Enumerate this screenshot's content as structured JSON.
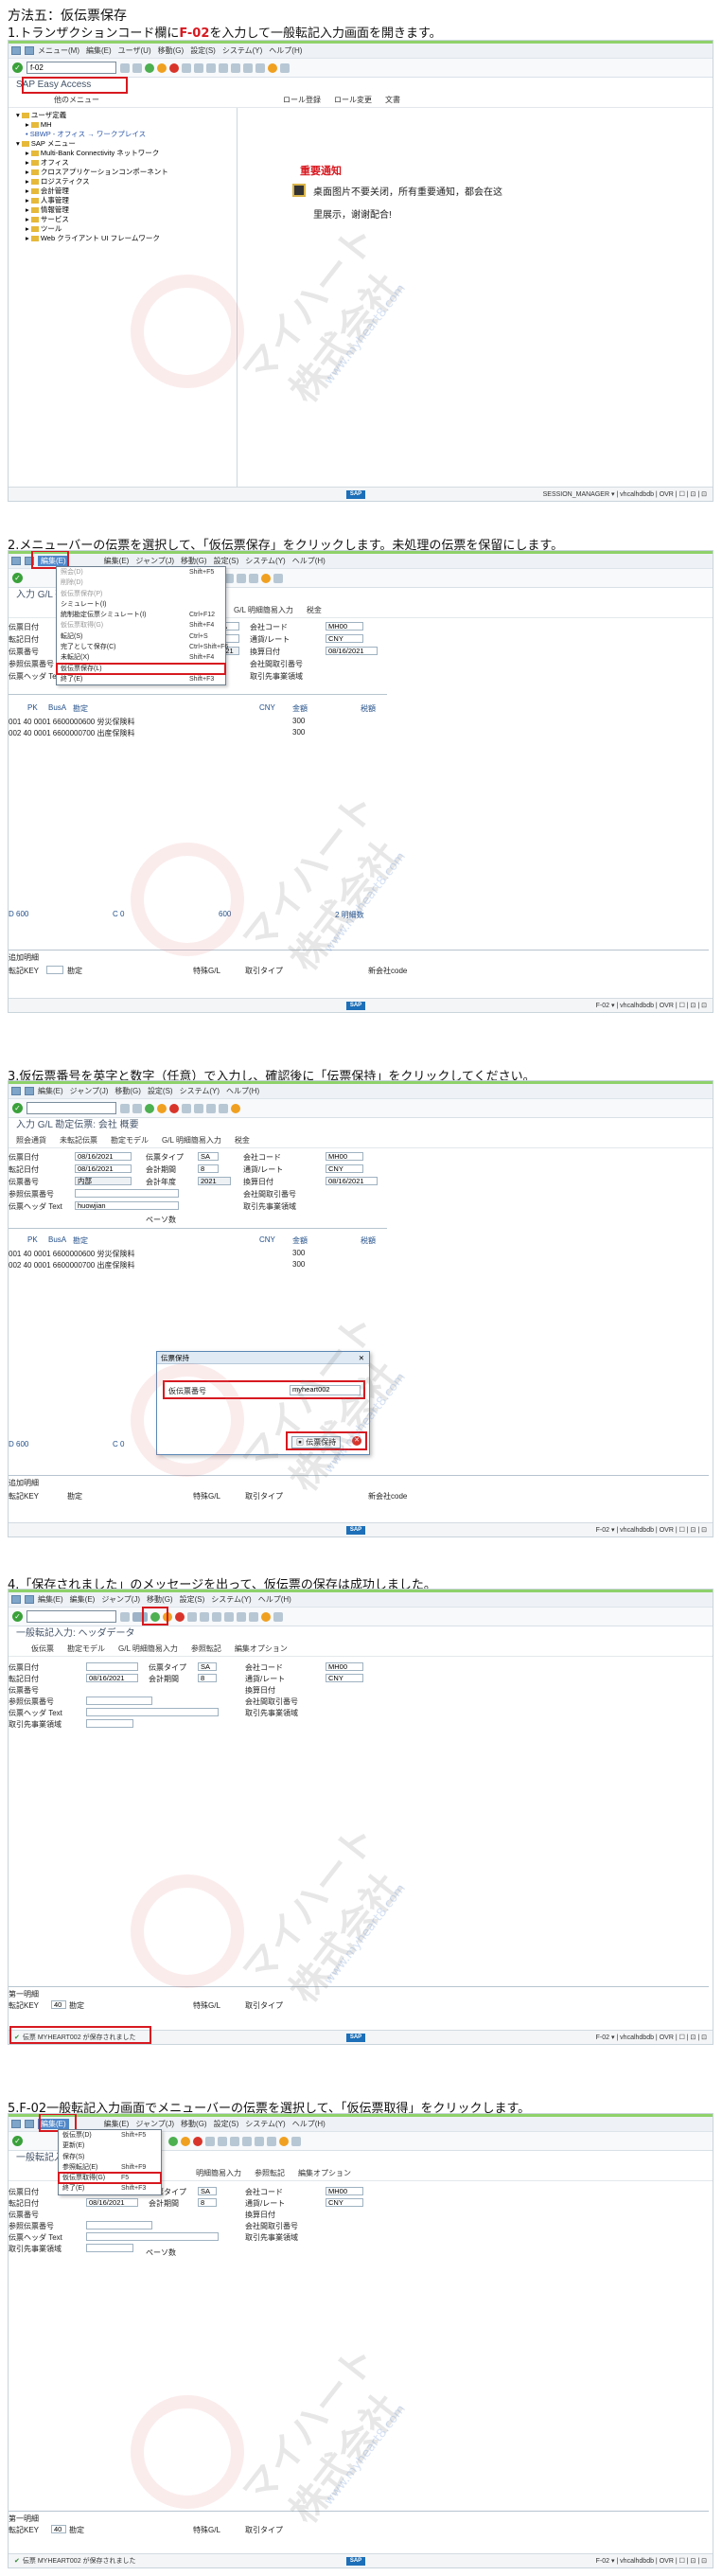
{
  "heading": "方法五：仮伝票保存",
  "menu_labels": [
    "メニュー(M)",
    "編集(E)",
    "ユーザ(U)",
    "移動(G)",
    "ジャンプ(J)",
    "設定(S)",
    "システム(Y)",
    "ヘルプ(H)"
  ],
  "steps": [
    {
      "caption": "1.トランザクションコード欄にF-02を入力して一般転記入力画面を開きます。",
      "caption_pre": "1.トランザクションコード欄に",
      "caption_hl": "F-02",
      "caption_post": "を入力して一般転記入力画面を開きます。"
    },
    {
      "caption": "2.メニューバーの伝票を選択して、「仮伝票保存」をクリックします。未処理の伝票を保留にします。"
    },
    {
      "caption": "3.仮伝票番号を英字と数字（任意）で入力し、確認後に「伝票保持」をクリックしてください。"
    },
    {
      "caption": "4.「保存されました」のメッセージを出って、仮伝票の保存は成功しました。"
    },
    {
      "caption": "5.F-02一般転記入力画面でメニューバーの伝票を選択して、「仮伝票取得」をクリックします。"
    }
  ],
  "win1": {
    "command_value": "f-02",
    "title": "SAP Easy Access",
    "app_toolbar": [
      "他のメニュー",
      "ロール登録",
      "ロール変更",
      "文書"
    ],
    "tree": [
      "ユーザ定義",
      "MH",
      "SBWP - オフィス → ワークプレイス",
      "SAP メニュー",
      "Multi-Bank Connectivity ネットワーク",
      "オフィス",
      "クロスアプリケーションコンポーネント",
      "ロジスティクス",
      "会計管理",
      "人事管理",
      "情報管理",
      "サービス",
      "ツール",
      "Web クライアント UI フレームワーク"
    ],
    "notice_title": "重要通知",
    "notice_text1": "桌面图片不要关闭，所有重要通知，都会在这",
    "notice_text2": "里展示，谢谢配合!",
    "status_right": "SESSION_MANAGER ▾ | vhcalhdbdb | OVR | ☐ | ⊡ | ⊡"
  },
  "win2": {
    "title": "入力 G/L 勘定伝票: 会社",
    "menu": [
      {
        "label": "照会(D)",
        "key": "Shift+F5"
      },
      {
        "label": "削除(D)",
        "key": ""
      },
      {
        "label": "仮伝票保存(P)",
        "key": ""
      },
      {
        "label": "シミュレート(I)",
        "key": ""
      },
      {
        "label": "統制勘定伝票シミュレート(I)",
        "key": "Ctrl+F12"
      },
      {
        "label": "仮伝票取得(G)",
        "key": "Shift+F4"
      },
      {
        "label": "転記(S)",
        "key": "Ctrl+S"
      },
      {
        "label": "完了として保存(C)",
        "key": "Ctrl+Shift+F6"
      },
      {
        "label": "未転記(X)",
        "key": "Shift+F4"
      },
      {
        "label": "仮伝票保存(L)",
        "key": ""
      },
      {
        "label": "終了(E)",
        "key": "Shift+F3"
      }
    ],
    "tabs": [
      "G/L 明細簡易入力",
      "税金"
    ],
    "fields_left": [
      "伝票日付",
      "転記日付",
      "伝票番号",
      "参照伝票番号",
      "伝票ヘッダ Text"
    ],
    "fields_right": [
      [
        "SA",
        "会社コード",
        "MH00"
      ],
      [
        "0",
        "通貨/レート",
        "CNY"
      ],
      [
        "2021",
        "換算日付",
        "08/16/2021"
      ],
      [
        "",
        "会社間取引番号",
        ""
      ],
      [
        "",
        "取引先事業領域",
        ""
      ]
    ],
    "items_header": [
      "PK",
      "BusA",
      "勘定",
      "",
      "CNY",
      "金額",
      "税額"
    ],
    "items": [
      [
        "001",
        "40",
        "0001",
        "6600000600",
        "労災保険料",
        "300"
      ],
      [
        "002",
        "40",
        "0001",
        "6600000700",
        "出産保険料",
        "300"
      ]
    ],
    "d_value": "600",
    "c_value": "0",
    "amount": "600",
    "count": "2 明細数",
    "bottom_title": "追加明細",
    "bottom_fields": [
      "転記KEY",
      "勘定",
      "特殊G/L",
      "取引タイプ",
      "新会社code"
    ],
    "status_right": "F-02 ▾ | vhcalhdbdb | OVR | ☐ | ⊡ | ⊡"
  },
  "win3": {
    "title": "入力 G/L 勘定伝票: 会社 概要",
    "app_toolbar": [
      "照会通貨",
      "未転記伝票",
      "勘定モデル",
      "G/L 明細簡易入力",
      "税金"
    ],
    "fields_left": [
      [
        "伝票日付",
        "08/16/2021"
      ],
      [
        "転記日付",
        "08/16/2021"
      ],
      [
        "伝票番号",
        "内部"
      ],
      [
        "参照伝票番号",
        ""
      ],
      [
        "伝票ヘッダ Text",
        "huowjian"
      ]
    ],
    "fields_right": [
      [
        "伝票タイプ",
        "SA",
        "会社コード",
        "MH00"
      ],
      [
        "会計期間",
        "8",
        "通貨/レート",
        "CNY"
      ],
      [
        "会計年度",
        "2021",
        "換算日付",
        "08/16/2021"
      ],
      [
        "",
        "",
        "会社間取引番号",
        ""
      ],
      [
        "",
        "",
        "取引先事業領域",
        ""
      ]
    ],
    "ref_key": "ペーソ数",
    "dialog_title": "伝票保持",
    "dialog_label": "仮伝票番号",
    "dialog_value": "myheart002",
    "dialog_button": "伝票保持",
    "status_right": "F-02 ▾ | vhcalhdbdb | OVR | ☐ | ⊡ | ⊡"
  },
  "win4": {
    "title": "一般転記入力: ヘッダデータ",
    "app_toolbar": [
      "仮伝票",
      "勘定モデル",
      "G/L 明細簡易入力",
      "参照転記",
      "編集オプション"
    ],
    "fields_left": [
      [
        "伝票日付",
        ""
      ],
      [
        "転記日付",
        "08/16/2021"
      ],
      [
        "伝票番号",
        ""
      ],
      [
        "参照伝票番号",
        ""
      ],
      [
        "伝票ヘッダ Text",
        ""
      ],
      [
        "取引先事業領域",
        ""
      ]
    ],
    "fields_right": [
      [
        "伝票タイプ",
        "SA",
        "会社コード",
        "MH00"
      ],
      [
        "会計期間",
        "8",
        "通貨/レート",
        "CNY"
      ],
      [
        "",
        "",
        "換算日付",
        ""
      ],
      [
        "",
        "",
        "会社間取引番号",
        ""
      ],
      [
        "",
        "",
        "取引先事業領域",
        ""
      ]
    ],
    "first_item": "第一明細",
    "bottom_fields": [
      "転記KEY",
      "40",
      "勘定",
      "特殊G/L",
      "取引タイプ"
    ],
    "message": "伝票 MYHEART002 が保存されました",
    "status_right": "F-02 ▾ | vhcalhdbdb | OVR | ☐ | ⊡ | ⊡"
  },
  "win5": {
    "title": "一般転記入力: ヘッダデータ",
    "app_toolbar": [
      "明細簡易入力",
      "参照転記",
      "編集オプション"
    ],
    "menu": [
      {
        "label": "仮伝票(D)",
        "key": "Shift+F5"
      },
      {
        "label": "更新(E)",
        "key": ""
      },
      {
        "label": "保存(S)",
        "key": ""
      },
      {
        "label": "参照転記(E)",
        "key": "Shift+F9"
      },
      {
        "label": "仮伝票取得(G)",
        "key": "F5"
      },
      {
        "label": "終了(E)",
        "key": "Shift+F3"
      }
    ],
    "fields_left": [
      [
        "伝票日付",
        ""
      ],
      [
        "転記日付",
        "08/16/2021"
      ],
      [
        "伝票番号",
        ""
      ],
      [
        "参照伝票番号",
        ""
      ],
      [
        "伝票ヘッダ Text",
        ""
      ],
      [
        "取引先事業領域",
        ""
      ]
    ],
    "fields_right": [
      [
        "伝票タイプ",
        "SA",
        "会社コード",
        "MH00"
      ],
      [
        "会計期間",
        "8",
        "通貨/レート",
        "CNY"
      ],
      [
        "",
        "",
        "換算日付",
        ""
      ],
      [
        "",
        "",
        "会社間取引番号",
        ""
      ],
      [
        "",
        "",
        "取引先事業領域",
        ""
      ]
    ],
    "first_item": "第一明細",
    "bottom_fields": [
      "転記KEY",
      "40",
      "勘定",
      "特殊G/L",
      "取引タイプ"
    ],
    "message": "伝票 MYHEART002 が保存されました",
    "status_right": "F-02 ▾ | vhcalhdbdb | OVR | ☐ | ⊡ | ⊡"
  },
  "watermark": {
    "kana": "マイハート",
    "kanji": "株式会社",
    "en": "MY HEART",
    "url": "www.myheart8.com"
  },
  "accent_red": "#d71920",
  "accent_green": "#8ed16a"
}
